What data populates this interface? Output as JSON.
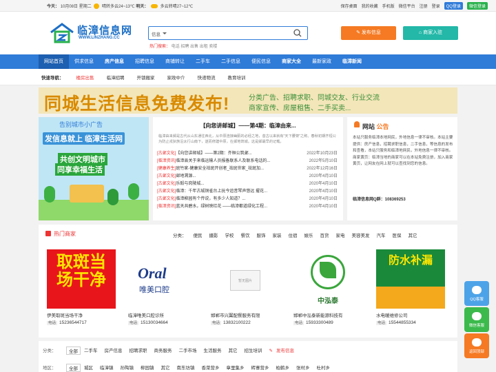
{
  "topbar": {
    "today_label": "今天：",
    "date": "10月08日 星期二",
    "weather1": "晴转多云24~13℃",
    "tomorrow_label": "明天：",
    "weather2": "多云转晴27~12℃",
    "links": [
      "保存桌面",
      "我的收藏",
      "手机版",
      "微信平台",
      "注册",
      "登录"
    ],
    "qq_login": "QQ登录",
    "wechat_login": "微信登录"
  },
  "logo": {
    "title": "临漳信息网",
    "url": "WWW.LINZHANG.CC"
  },
  "search": {
    "category": "信息",
    "placeholder": "",
    "hot_label": "热门搜索：",
    "hot_words": "电话 招聘 出售 出租 卖楼"
  },
  "actions": {
    "publish": "发布信息",
    "join": "商家入驻"
  },
  "nav": [
    "网站首页",
    "供求信息",
    "房产信息",
    "招聘信息",
    "商铺转让",
    "二手车",
    "二手信息",
    "便民信息",
    "商家大全",
    "最新家政",
    "临漳新闻"
  ],
  "quick": {
    "label": "快速导航：",
    "items": [
      "楼房出售",
      "临漳招聘",
      "开锁搬家",
      "家政中介",
      "快递物流",
      "教育培训"
    ]
  },
  "banner": {
    "headline": "同城生活信息免费发布!",
    "line1": "分类广告、招聘求职、同城交友、行业交流",
    "line2": "商家宣传、房屋租售、二手买卖..."
  },
  "left_ad": {
    "line1": "告别城市小广告",
    "line2": "发信息就上 临漳生活网",
    "line3": "共创文明城市",
    "line4": "同享幸福生活"
  },
  "featured": {
    "title": "【向您讲邮城】——第4期：临漳由来...",
    "desc": "临漳由来邺是古代从山东通往西北，从中原连接幽蓟的必经之地，昔古以来就有\"天下腰膂\"之称。春秋初期齐桓公为防止戎狄族沿太行山南下，遂而修建中原，在邺地筑城。这是邺最早的记载。",
    "items": [
      {
        "cat": "[古邺文化]",
        "text": "【向您讲邮城】——第2期：齐桓公筑邺...",
        "date": "2022年10月23日"
      },
      {
        "cat": "[临漳资讯]",
        "text": "临漳县关于来临运输人员报备联系人及联系电话的...",
        "date": "2022年5月10日"
      },
      {
        "cat": "[健康养生]",
        "text": "斑竹家-健康安全祛斑开创者_祛斑世家_祛斑加...",
        "date": "2022年12月16日"
      },
      {
        "cat": "[古邺文化]",
        "text": "邺地溯源...",
        "date": "2020年4月10日"
      },
      {
        "cat": "[古邺文化]",
        "text": "乐毅与岗陵城...",
        "date": "2020年4月10日"
      },
      {
        "cat": "[古邺文化]",
        "text": "临漳：千年古城铜雀台上抚今追昔琴声悠远 擢花...",
        "date": "2020年4月10日"
      },
      {
        "cat": "[古邺文化]",
        "text": "临漳柳园有个传说，有多少人知道？...",
        "date": "2020年4月10日"
      },
      {
        "cat": "[临漳资讯]",
        "text": "蓝天共碧水，绿树映红花 ——临漳都道绿化工程...",
        "date": "2020年4月10日"
      }
    ]
  },
  "notice": {
    "title_a": "网站",
    "title_b": "公告",
    "text": "本站只服务临漳本地网民，外地信息一律不审核。本站主要提供：房产信息，招聘求职信息，二手信息，等信息的发布和查看，本站只服务和临漳地网民，外地信息一律不审核。商家黄页：临漳当地的商家可以在本站免费注册，加入商家黄页，让网友在网上就可以查找到您的信息。",
    "qq": "临漳信息网Q群：108369253"
  },
  "shops": {
    "title": "热门商家",
    "cats_label": "分类：",
    "cats": [
      "便民",
      "摄影",
      "学校",
      "餐饮",
      "服饰",
      "家装",
      "住宿",
      "娱乐",
      "百货",
      "家电",
      "美容美发",
      "汽车",
      "医保",
      "其它"
    ],
    "cards": [
      {
        "name": "伊美取斑当场干净",
        "phone": "15236544717",
        "img_text": "取斑当场干净"
      },
      {
        "name": "临漳唯美口腔诊所",
        "phone": "15130034664",
        "img_text": "唯美口腔"
      },
      {
        "name": "邯郸市兴翼配餐服务有限",
        "phone": "13832100222",
        "img_text": "暂无图片"
      },
      {
        "name": "邯郸中泓泰新能源科技有",
        "phone": "15933300489",
        "img_text": "中泓泰"
      },
      {
        "name": "水电暖维修公司",
        "phone": "15544855334",
        "img_text": "防水补漏"
      }
    ],
    "phone_tag": "电话"
  },
  "filters": {
    "cat_label": "分类：",
    "cats": [
      "全部",
      "二手车",
      "房产信息",
      "招聘求职",
      "商务服务",
      "二手市场",
      "生活服务",
      "其它",
      "招生培训"
    ],
    "publish": "发布信息",
    "area_label": "地区：",
    "areas": [
      "全部",
      "城区",
      "临漳镇",
      "孙陶镇",
      "柳园镇",
      "其它",
      "南东坊镇",
      "香菜营乡",
      "章里集乡",
      "砖寨营乡",
      "柏鹤乡",
      "张村乡",
      "杜村乡"
    ]
  },
  "side": [
    "QQ客服",
    "微信客服",
    "返回顶部"
  ]
}
